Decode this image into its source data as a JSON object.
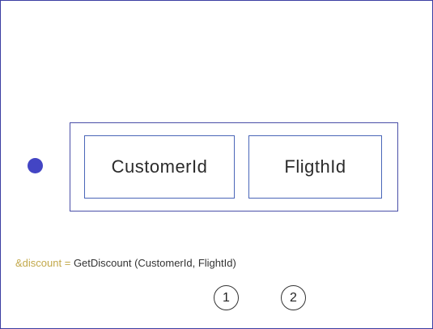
{
  "diagram": {
    "attributes": [
      {
        "label": "CustomerId"
      },
      {
        "label": "FligthId"
      }
    ],
    "formula": {
      "variable": "&discount",
      "equals": "=",
      "expression": "GetDiscount (CustomerId, FlightId)"
    },
    "markers": [
      "1",
      "2"
    ],
    "colors": {
      "frame": "#3b3fa3",
      "bullet": "#4345c4",
      "variable": "#c2a84a"
    }
  }
}
